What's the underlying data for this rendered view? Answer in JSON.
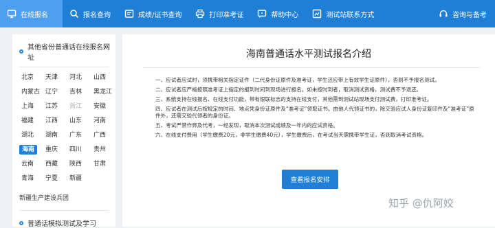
{
  "nav": {
    "items": [
      {
        "label": "在线报名",
        "icon": "monitor-icon"
      },
      {
        "label": "报名查询",
        "icon": "search-icon"
      },
      {
        "label": "成绩/证书查询",
        "icon": "certificate-icon"
      },
      {
        "label": "打印准考证",
        "icon": "printer-icon"
      },
      {
        "label": "帮助中心",
        "icon": "help-icon"
      },
      {
        "label": "测试站联系方式",
        "icon": "contact-icon"
      }
    ],
    "consult_label": "咨询与备考",
    "active_color": "#4f9ff0",
    "bar_color": "#1f7fd6"
  },
  "sidebar": {
    "title": "其他省份普通话在线报名网址",
    "provinces": [
      "北京",
      "天津",
      "河北",
      "山西",
      "内蒙古",
      "辽宁",
      "吉林",
      "黑龙江",
      "上海",
      "江苏",
      "浙江",
      "安徽",
      "福建",
      "江西",
      "山东",
      "河南",
      "湖北",
      "湖南",
      "广东",
      "广西",
      "海南",
      "重庆",
      "四川",
      "贵州",
      "云南",
      "西藏",
      "陕西",
      "甘肃",
      "青海",
      "宁夏",
      "新疆"
    ],
    "selected": "海南",
    "disabled": [
      "浙江"
    ],
    "corps": "新疆生产建设兵团",
    "section2_title": "普通话模拟测试及学习"
  },
  "main": {
    "title": "海南普通话水平测试报名介绍",
    "paragraphs": [
      "一、应试者应试时，须携带相关指定证件（二代身份证原件及准考证，学生还应带上有效学生证原件），否则不予报名测试。",
      "二、应试者应严格按照准考证上指定的报到时间到现场进行报名。如未按时到者，取消测试资格，测试费不予退还。",
      "三、系统支持在线报名、在线支付功能，带有银联标志的支持在线支付，其他需到测试站现场支付测试费，打印准考证。",
      "四、应试者在测试后按规定的时间、地点凭身份证原件及“准考证”领取证书。由他人代领证书的，除交验应试人身份证复印件及“准考证”原件外，还需交验代领者的身份证。",
      "五、考试严禁作弊及代考，一经发现，取消本次测试成绩及一年内的应试资格。",
      "六、在线支付费用（学生缴费20元，非学生缴费40元），学生缴费后，在考试当天需携带学生证，否则取消考试资格。"
    ],
    "button_label": "查看报名安排"
  },
  "watermark": "知乎 @仇阿姣"
}
